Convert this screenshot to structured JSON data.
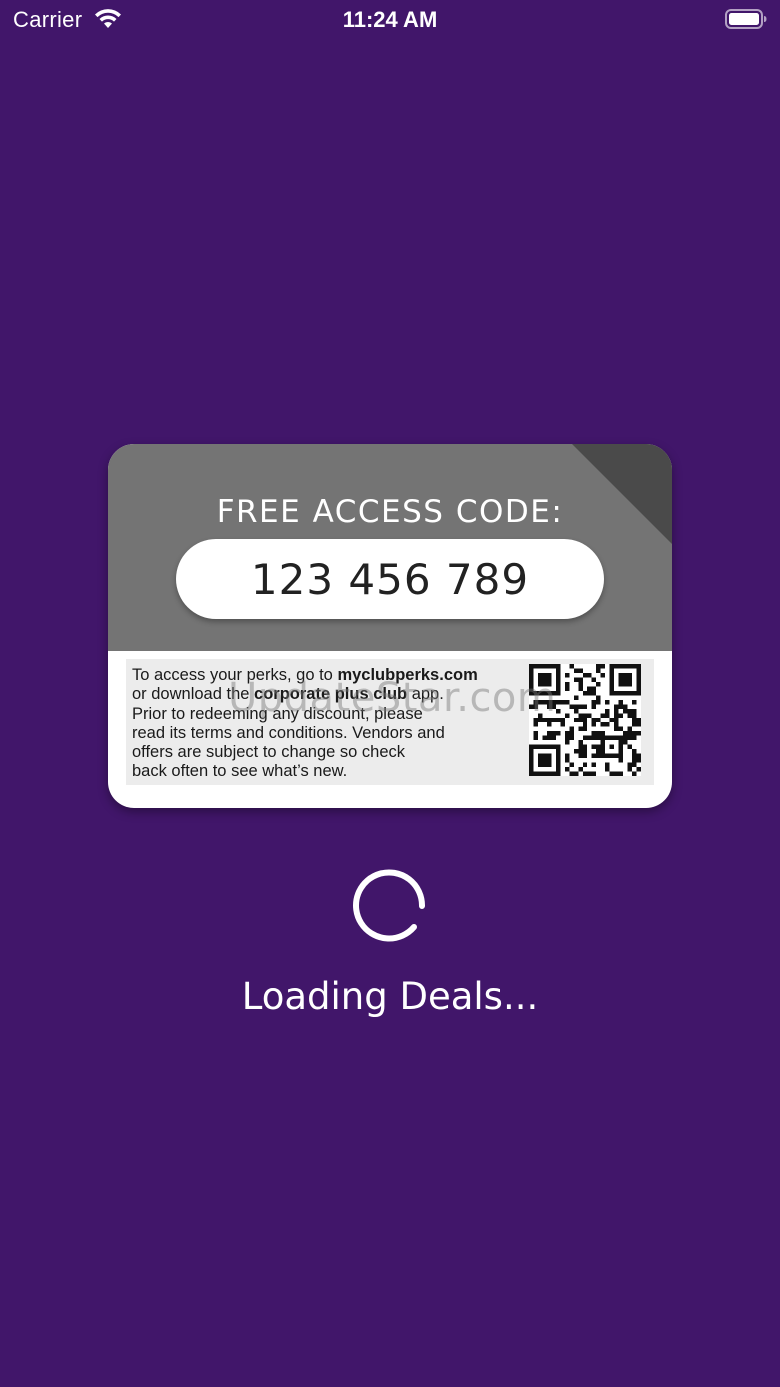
{
  "status_bar": {
    "carrier": "Carrier",
    "time": "11:24 AM",
    "wifi_icon": "wifi-icon",
    "battery_icon": "battery-icon"
  },
  "card": {
    "heading": "FREE ACCESS CODE:",
    "code": "123 456 789",
    "info": {
      "line1_prefix": "To access your perks, go to ",
      "line1_link": "myclubperks.com",
      "line2_prefix": "or download the ",
      "line2_app": "corporate plus club",
      "line2_suffix": " app.",
      "line3": "Prior to redeeming any discount, please",
      "line4": "read its terms and conditions. Vendors and",
      "line5": "offers are subject to change so check",
      "line6": "back often to see what’s new."
    },
    "qr_icon": "qr-code-icon"
  },
  "watermark": "UpdateStar.com",
  "loader": {
    "text": "Loading Deals...",
    "spinner_icon": "spinner-icon"
  },
  "colors": {
    "background": "#41166a",
    "card_top": "#747474",
    "card_corner": "#4a4a4a"
  }
}
